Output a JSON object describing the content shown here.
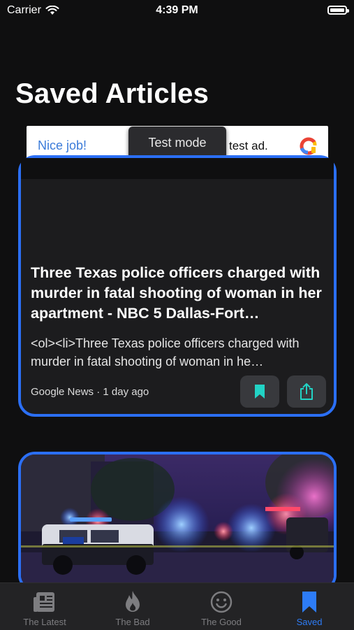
{
  "status_bar": {
    "carrier": "Carrier",
    "time": "4:39 PM"
  },
  "page": {
    "title": "Saved Articles"
  },
  "ad": {
    "left_text": "Nice job!",
    "overlay": "Test mode",
    "right_text": "test ad."
  },
  "article": {
    "title": "Three Texas police officers charged with murder in fatal shooting of woman in her apartment - NBC 5 Dallas-Fort…",
    "description": "<ol><li>Three Texas police officers charged with murder in fatal shooting of woman in he…",
    "meta": "Google News · 1 day ago"
  },
  "tabs": [
    {
      "label": "The Latest",
      "icon": "newspaper-icon"
    },
    {
      "label": "The Bad",
      "icon": "flame-icon"
    },
    {
      "label": "The Good",
      "icon": "smiley-icon"
    },
    {
      "label": "Saved",
      "icon": "bookmark-icon",
      "active": true
    }
  ],
  "colors": {
    "accent": "#2B6FF5",
    "tab_active": "#2D7CF7",
    "bookmark_teal": "#22D3C5",
    "background": "#0F0F10"
  }
}
